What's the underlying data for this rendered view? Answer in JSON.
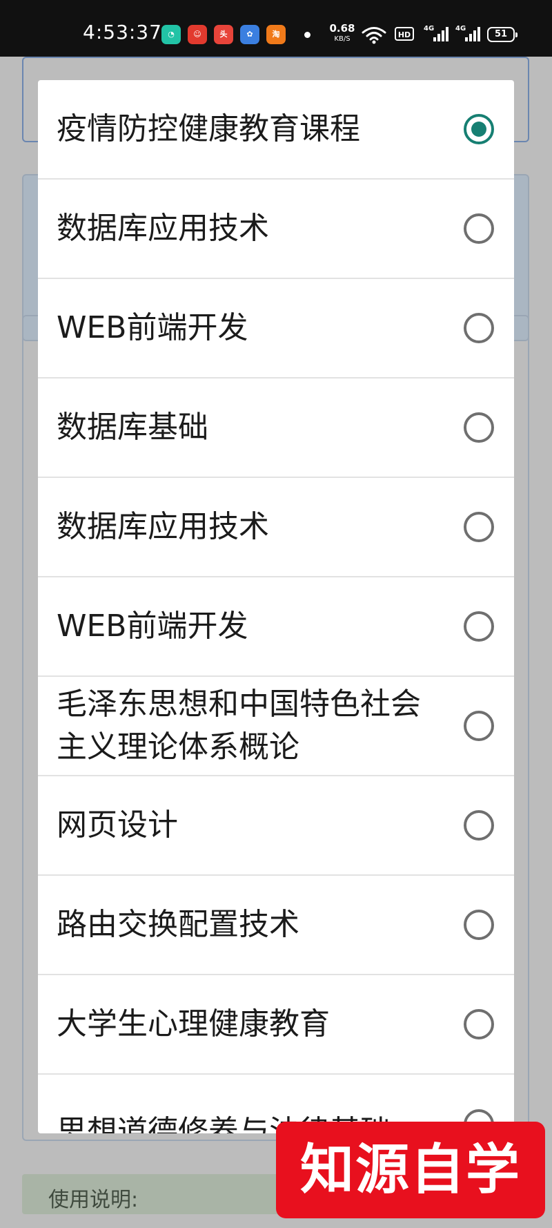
{
  "status_bar": {
    "time": "4:53:37",
    "net_speed_value": "0.68",
    "net_speed_unit": "KB/S",
    "hd_label": "HD",
    "signal_1_label": "4G",
    "signal_2_label": "4G",
    "battery_level": "51",
    "notification_icons": [
      "wechat-icon",
      "app-icon",
      "toutiao-icon",
      "baidu-icon",
      "taobao-icon"
    ]
  },
  "dialog": {
    "options": [
      {
        "label": "疫情防控健康教育课程",
        "selected": true
      },
      {
        "label": "数据库应用技术",
        "selected": false
      },
      {
        "label": "WEB前端开发",
        "selected": false
      },
      {
        "label": "数据库基础",
        "selected": false
      },
      {
        "label": "数据库应用技术",
        "selected": false
      },
      {
        "label": "WEB前端开发",
        "selected": false
      },
      {
        "label": "毛泽东思想和中国特色社会主义理论体系概论",
        "selected": false
      },
      {
        "label": "网页设计",
        "selected": false
      },
      {
        "label": "路由交换配置技术",
        "selected": false
      },
      {
        "label": "大学生心理健康教育",
        "selected": false
      },
      {
        "label": "思想道德修养与法律基础",
        "selected": false
      }
    ]
  },
  "background": {
    "instructions_label": "使用说明:"
  },
  "watermark": {
    "text": "知源自学堂"
  },
  "colors": {
    "accent": "#167f72",
    "watermark": "#e8101e",
    "status_bar": "#111111"
  }
}
